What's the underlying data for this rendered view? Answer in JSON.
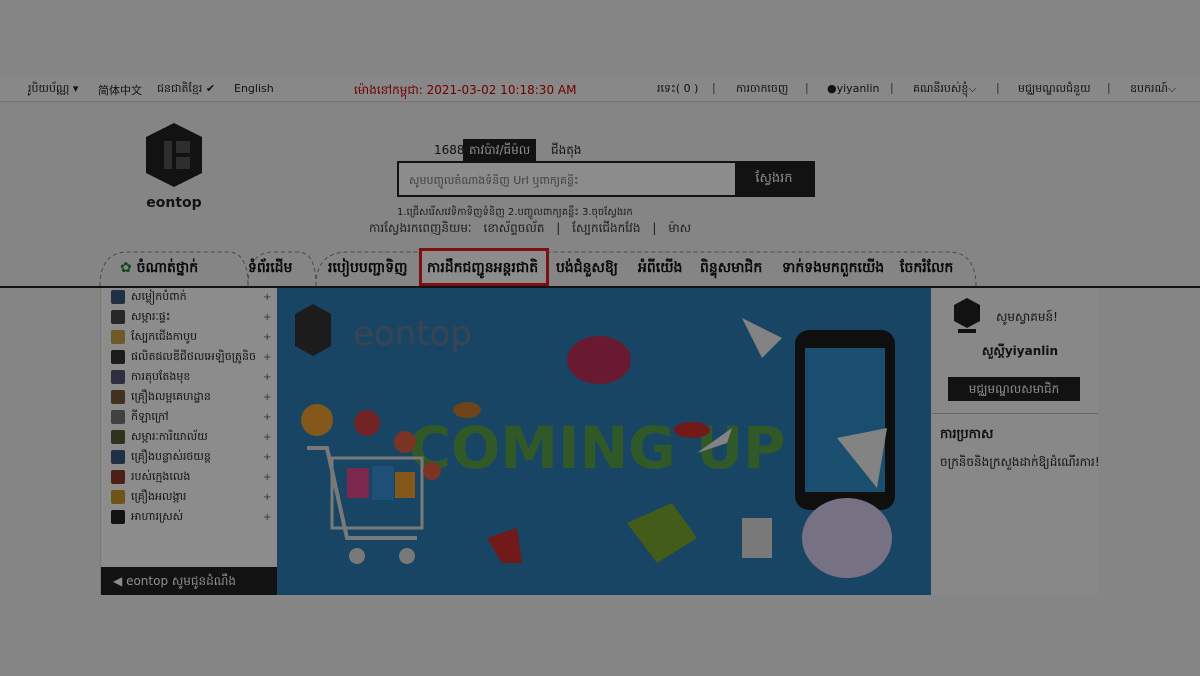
{
  "topbar": {
    "currency": "រូបិយប័ណ្ណ",
    "lang_zh": "简体中文",
    "lang_km": "ជនជាតិខ្មែរ ✔",
    "lang_en": "English",
    "time_label": "ម៉ោងនៅកម្ពុជា:",
    "time_value": "2021-03-02 10:18:30 AM",
    "cart": "រទេះ( 0 )",
    "logout": "ការចាកចេញ",
    "username": "yiyanlin",
    "my_account": "គណនីរបស់ខ្ញុំ",
    "help_center": "មជ្ឈមណ្ឌលជំនួយ",
    "website": "ឧបករណ៍"
  },
  "logo": {
    "text": "eontop"
  },
  "search": {
    "tabs": [
      "1688",
      "តាវប៉ាវ/ធីម៉ល",
      "ជីងតុង"
    ],
    "placeholder": "សូមបញ្ចូលតំណាងទំនិញ Url ឬពាក្យគន្លឹះ",
    "button": "ស្វែងរក",
    "hints": "1.ជ្រើសរើសវេទិកាទិញទំនិញ  2.បញ្ចូលពាក្យគន្លឹះ  3.ចុចស្វែងរក",
    "hot_words": [
      "ការស្វែងរកពេញនិយមៈ",
      "ខោស័ព្ទចល័ត",
      "|",
      "ស្បែកជើងកវែង",
      "|",
      "ម៉ាស"
    ]
  },
  "nav": {
    "categories": "ចំណាត់ថ្នាក់",
    "home": "ទំព័រដើម",
    "items": [
      "របៀបបញ្ជាទិញ",
      "ការដឹកជញ្ជូនអន្តរជាតិ",
      "បង់ជំនួសឱ្យ",
      "អំពីយើង",
      "ពិន្ទុសមាជិក",
      "ទាក់ទងមកពួកយើង",
      "ចែករំលែក"
    ]
  },
  "sidebar": {
    "categories": [
      {
        "label": "សម្លៀកបំពាក់",
        "color": "#3b5a7a"
      },
      {
        "label": "សម្ភារៈផ្ទះ",
        "color": "#4a4a4a"
      },
      {
        "label": "ស្បែកជើងកាបូប",
        "color": "#c8a24a"
      },
      {
        "label": "ផលិតផលឌីជីថលអេឡិចត្រូនិច",
        "color": "#333333"
      },
      {
        "label": "ការតុបតែងមុខ",
        "color": "#555577"
      },
      {
        "label": "គ្រឿងលម្អគេហដ្ឋាន",
        "color": "#7a5a3a"
      },
      {
        "label": "កីឡាក្រៅ",
        "color": "#777777"
      },
      {
        "label": "សម្ភារៈការិយាល័យ",
        "color": "#5a5a3a"
      },
      {
        "label": "គ្រឿងបន្លាស់រថយន្ត",
        "color": "#3a5a7a"
      },
      {
        "label": "របស់ក្មេងលេង",
        "color": "#8a3a2a"
      },
      {
        "label": "គ្រឿងអលង្ការ",
        "color": "#c89a2a"
      },
      {
        "label": "អាហារស្រស់",
        "color": "#222222"
      }
    ],
    "footer": "eontop សូមជូនដំណឹង"
  },
  "banner": {
    "logo_text": "eontop",
    "headline": "COMING UP"
  },
  "panel": {
    "welcome": "សូមស្វាគមន៍!",
    "user": "សួស្តីyiyanlin",
    "member_center": "មជ្ឈមណ្ឌលសមាជិក",
    "notice_title": "ការប្រកាស",
    "notice": "ចក្រនិចនិងក្រសួងដាក់ឱ្យដំណើរការ!"
  },
  "colors": {
    "highlight_border": "#e21d1d",
    "banner_bg": "#2a7fb4",
    "accent_dark": "#222222"
  }
}
